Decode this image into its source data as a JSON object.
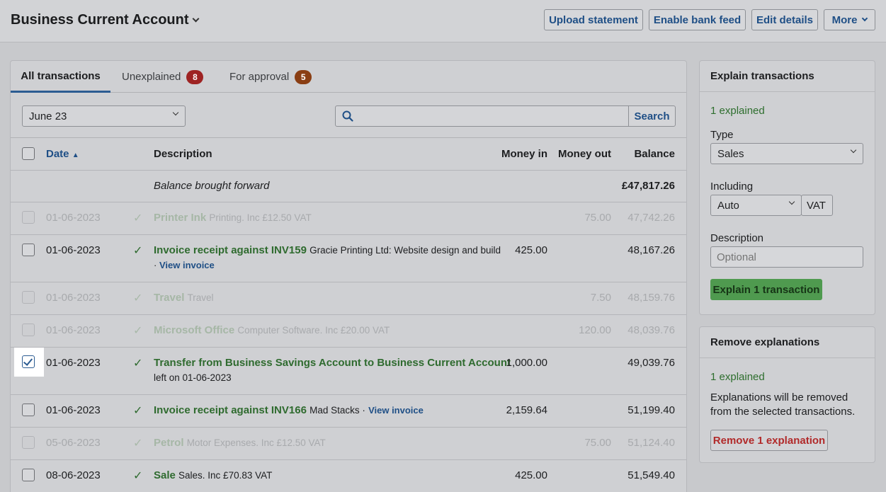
{
  "header": {
    "account_title": "Business Current Account",
    "buttons": {
      "upload": "Upload statement",
      "bank_feed": "Enable bank feed",
      "edit": "Edit details",
      "more": "More"
    }
  },
  "tabs": [
    {
      "label": "All transactions",
      "active": true
    },
    {
      "label": "Unexplained",
      "count": "8",
      "badge_color": "#9e2323"
    },
    {
      "label": "For approval",
      "count": "5",
      "badge_color": "#8a3e13"
    }
  ],
  "filters": {
    "period": "June 23",
    "search_placeholder": "",
    "search_label": "Search"
  },
  "table": {
    "headers": {
      "date": "Date",
      "description": "Description",
      "money_in": "Money in",
      "money_out": "Money out",
      "balance": "Balance"
    },
    "brought_forward": {
      "label": "Balance brought forward",
      "balance": "£47,817.26"
    },
    "rows": [
      {
        "date": "01-06-2023",
        "title": "Printer Ink",
        "sub": "Printing. Inc £12.50 VAT",
        "link": "",
        "line2": "",
        "in": "",
        "out": "75.00",
        "balance": "47,742.26",
        "dim": true,
        "checked": false
      },
      {
        "date": "01-06-2023",
        "title": "Invoice receipt against INV159",
        "sub": "Gracie Printing Ltd: Website design and build",
        "link": "View invoice",
        "line2": "·",
        "in": "425.00",
        "out": "",
        "balance": "48,167.26",
        "dim": false,
        "checked": false
      },
      {
        "date": "01-06-2023",
        "title": "Travel",
        "sub": "Travel",
        "link": "",
        "line2": "",
        "in": "",
        "out": "7.50",
        "balance": "48,159.76",
        "dim": true,
        "checked": false
      },
      {
        "date": "01-06-2023",
        "title": "Microsoft Office",
        "sub": "Computer Software. Inc £20.00 VAT",
        "link": "",
        "line2": "",
        "in": "",
        "out": "120.00",
        "balance": "48,039.76",
        "dim": true,
        "checked": false
      },
      {
        "date": "01-06-2023",
        "title": "Transfer from Business Savings Account to Business Current Account",
        "sub": "",
        "link": "",
        "line2": "left on 01-06-2023",
        "in": "1,000.00",
        "out": "",
        "balance": "49,039.76",
        "dim": false,
        "checked": true
      },
      {
        "date": "01-06-2023",
        "title": "Invoice receipt against INV166",
        "sub": "Mad Stacks ·",
        "link": "View invoice",
        "line2": "",
        "in": "2,159.64",
        "out": "",
        "balance": "51,199.40",
        "dim": false,
        "checked": false
      },
      {
        "date": "05-06-2023",
        "title": "Petrol",
        "sub": "Motor Expenses. Inc £12.50 VAT",
        "link": "",
        "line2": "",
        "in": "",
        "out": "75.00",
        "balance": "51,124.40",
        "dim": true,
        "checked": false
      },
      {
        "date": "08-06-2023",
        "title": "Sale",
        "sub": "Sales. Inc £70.83 VAT",
        "link": "",
        "line2": "",
        "in": "425.00",
        "out": "",
        "balance": "51,549.40",
        "dim": false,
        "checked": false
      }
    ]
  },
  "explain_panel": {
    "title": "Explain transactions",
    "status": "1 explained",
    "type_label": "Type",
    "type_value": "Sales",
    "including_label": "Including",
    "including_value": "Auto",
    "vat_label": "VAT",
    "description_label": "Description",
    "description_placeholder": "Optional",
    "submit_label": "Explain 1 transaction"
  },
  "remove_panel": {
    "title": "Remove explanations",
    "status": "1 explained",
    "message": "Explanations will be removed from the selected transactions.",
    "button_label": "Remove 1 explanation"
  }
}
